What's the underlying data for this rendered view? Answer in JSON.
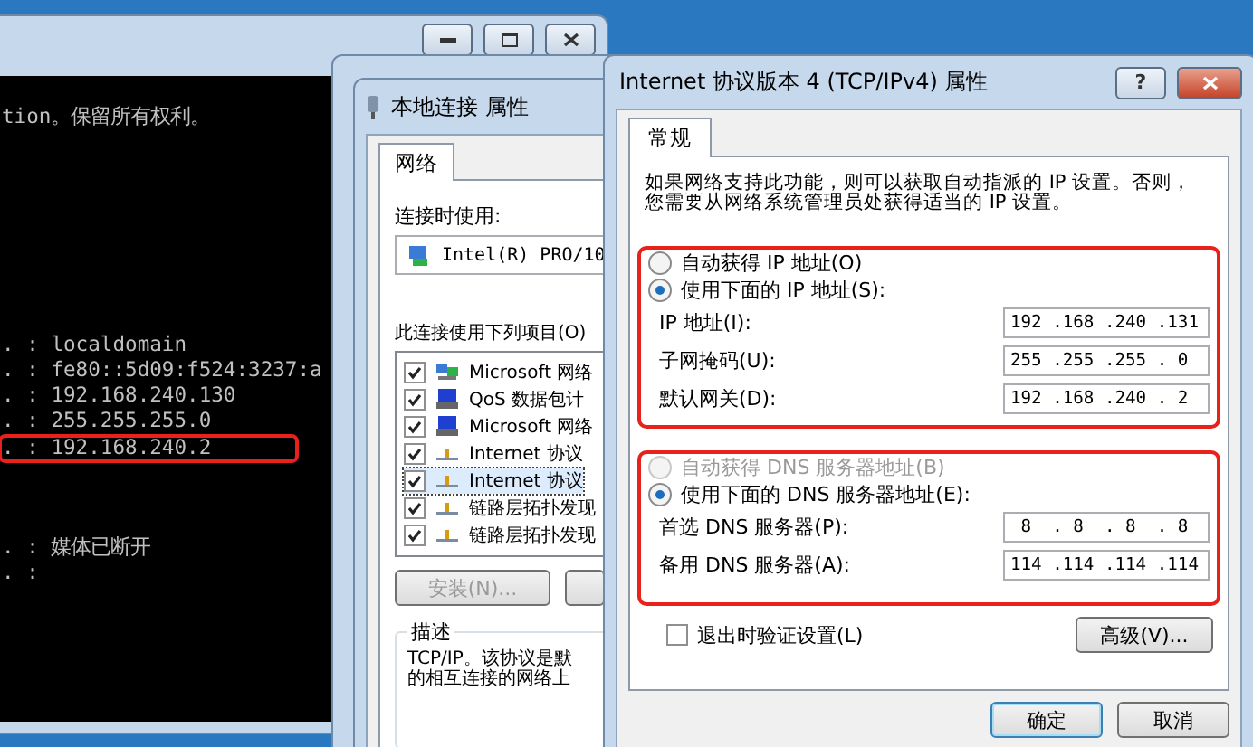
{
  "console_window": {
    "blocks": [
      [
        {
          "text": "tion。保留所有权利。",
          "highlighted": false
        }
      ],
      [
        {
          "text": ". : localdomain",
          "highlighted": false
        },
        {
          "text": ". : fe80::5d09:f524:3237:a",
          "highlighted": false
        },
        {
          "text": ". : 192.168.240.130",
          "highlighted": false
        },
        {
          "text": ". : 255.255.255.0",
          "highlighted": false
        },
        {
          "text": ". : 192.168.240.2",
          "highlighted": true
        }
      ],
      [
        {
          "text": ". : 媒体已断开",
          "highlighted": false
        },
        {
          "text": ". :",
          "highlighted": false
        }
      ]
    ]
  },
  "properties_window": {
    "title": "本地连接 属性",
    "tabs": [
      {
        "label": "网络",
        "selected": true
      }
    ],
    "connect_using_label": "连接时使用:",
    "adapter": "Intel(R) PRO/10",
    "items_label": "此连接使用下列项目(O)",
    "items": [
      {
        "label": "Microsoft 网络",
        "checked": true,
        "selected": false,
        "kind": "client"
      },
      {
        "label": "QoS 数据包计",
        "checked": true,
        "selected": false,
        "kind": "service"
      },
      {
        "label": "Microsoft 网络",
        "checked": true,
        "selected": false,
        "kind": "service"
      },
      {
        "label": "Internet 协议",
        "checked": true,
        "selected": false,
        "kind": "protocol"
      },
      {
        "label": "Internet 协议",
        "checked": true,
        "selected": true,
        "kind": "protocol"
      },
      {
        "label": "链路层拓扑发现",
        "checked": true,
        "selected": false,
        "kind": "protocol"
      },
      {
        "label": "链路层拓扑发现",
        "checked": true,
        "selected": false,
        "kind": "protocol"
      }
    ],
    "install_button": {
      "label": "安装(N)...",
      "disabled": true
    },
    "description_title": "描述",
    "description_lines": [
      "TCP/IP。该协议是默",
      "的相互连接的网络上"
    ]
  },
  "ipv4_window": {
    "title": "Internet 协议版本 4 (TCP/IPv4) 属性",
    "help_glyph": "?",
    "tabs": [
      {
        "label": "常规",
        "selected": true
      }
    ],
    "intro_lines": [
      "如果网络支持此功能，则可以获取自动指派的 IP 设置。否则，",
      "您需要从网络系统管理员处获得适当的 IP 设置。"
    ],
    "ip_group": {
      "highlighted": true,
      "radios": [
        {
          "label": "自动获得 IP 地址(O)",
          "selected": false,
          "disabled": false
        },
        {
          "label": "使用下面的 IP 地址(S):",
          "selected": true,
          "disabled": false
        }
      ],
      "fields": [
        {
          "label": "IP 地址(I):",
          "value": "192 .168 .240 .131"
        },
        {
          "label": "子网掩码(U):",
          "value": "255 .255 .255 . 0"
        },
        {
          "label": "默认网关(D):",
          "value": "192 .168 .240 . 2"
        }
      ]
    },
    "dns_group": {
      "highlighted": true,
      "radios": [
        {
          "label": "自动获得 DNS 服务器地址(B)",
          "selected": false,
          "disabled": true
        },
        {
          "label": "使用下面的 DNS 服务器地址(E):",
          "selected": true,
          "disabled": false
        }
      ],
      "fields": [
        {
          "label": "首选 DNS 服务器(P):",
          "value": " 8  . 8  . 8  . 8"
        },
        {
          "label": "备用 DNS 服务器(A):",
          "value": "114 .114 .114 .114"
        }
      ]
    },
    "validate_checkbox": {
      "label": "退出时验证设置(L)",
      "checked": false
    },
    "advanced_button": "高级(V)...",
    "buttons": [
      {
        "label": "确定",
        "default": true
      },
      {
        "label": "取消",
        "default": false
      }
    ]
  }
}
